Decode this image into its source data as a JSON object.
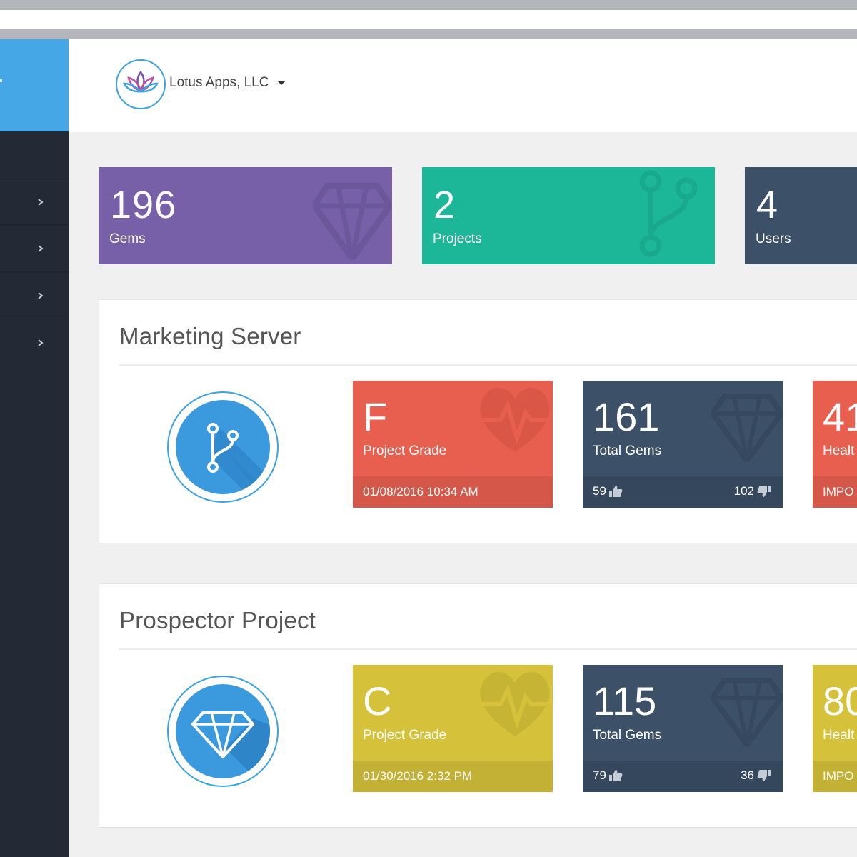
{
  "header": {
    "org_name": "Lotus Apps, LLC"
  },
  "sidebar": {
    "items": [
      {
        "icon": "chevron-right-icon"
      },
      {
        "icon": "chevron-right-icon"
      },
      {
        "icon": "chevron-right-icon"
      },
      {
        "icon": "chevron-right-icon"
      }
    ]
  },
  "stats": [
    {
      "value": "196",
      "label": "Gems",
      "color": "#7760a8",
      "icon": "diamond-icon"
    },
    {
      "value": "2",
      "label": "Projects",
      "color": "#1cb799",
      "icon": "branch-icon"
    },
    {
      "value": "4",
      "label": "Users",
      "color": "#3c5068",
      "icon": "users-icon"
    }
  ],
  "projects": [
    {
      "title": "Marketing Server",
      "icon": "branch-icon",
      "grade": {
        "value": "F",
        "label": "Project Grade",
        "date": "01/08/2016 10:34 AM",
        "color": "#e85f4f",
        "foot_color": "#d4574a"
      },
      "gems": {
        "value": "161",
        "label": "Total Gems",
        "up": "59",
        "down": "102",
        "color": "#3c5068",
        "foot_color": "#35475c"
      },
      "health": {
        "value": "41",
        "label": "Healt",
        "foot": "IMPO",
        "color": "#e85f4f",
        "foot_color": "#d4574a"
      }
    },
    {
      "title": "Prospector Project",
      "icon": "diamond-icon",
      "grade": {
        "value": "C",
        "label": "Project Grade",
        "date": "01/30/2016 2:32 PM",
        "color": "#d5c23a",
        "foot_color": "#c3b135"
      },
      "gems": {
        "value": "115",
        "label": "Total Gems",
        "up": "79",
        "down": "36",
        "color": "#3c5068",
        "foot_color": "#35475c"
      },
      "health": {
        "value": "80",
        "label": "Healt",
        "foot": "IMPO",
        "color": "#d5c23a",
        "foot_color": "#c3b135"
      }
    }
  ]
}
